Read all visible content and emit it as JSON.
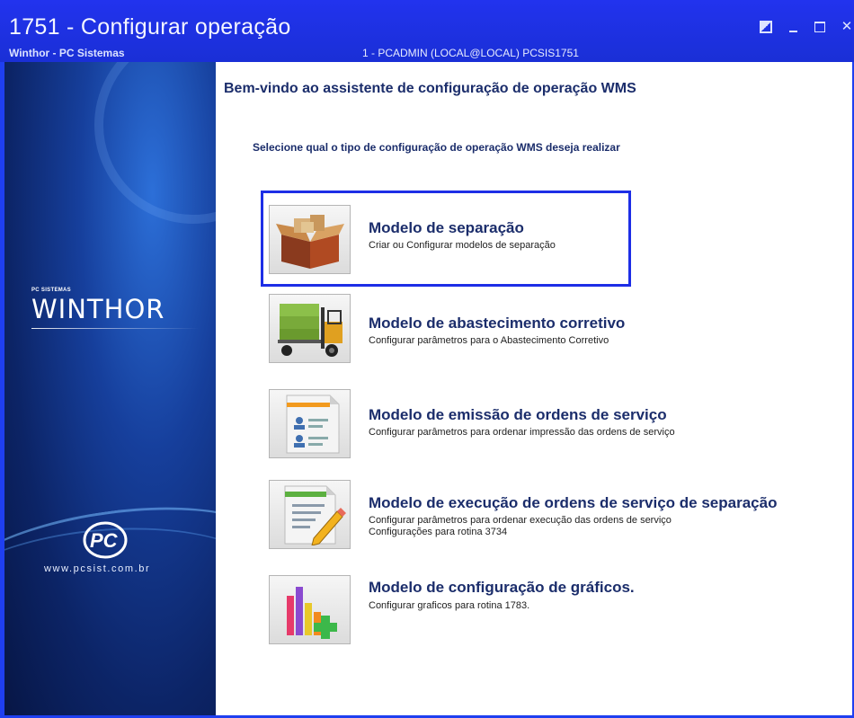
{
  "window": {
    "title": "1751 - Configurar operação",
    "subtitle": "Winthor - PC Sistemas",
    "user_info": "1 - PCADMIN (LOCAL@LOCAL)   PCSIS1751"
  },
  "sidebar": {
    "brand_small": "PC SISTEMAS",
    "brand_name": "WINTHOR",
    "url": "www.pcsist.com.br"
  },
  "main": {
    "welcome": "Bem-vindo ao assistente de configuração de operação WMS",
    "instruction": "Selecione qual o tipo de configuração de operação WMS deseja realizar",
    "options": [
      {
        "title": "Modelo de separação",
        "desc1": "Criar ou Configurar modelos de separação",
        "desc2": "",
        "icon": "box-icon"
      },
      {
        "title": "Modelo de abastecimento corretivo",
        "desc1": "Configurar parâmetros para o Abastecimento Corretivo",
        "desc2": "",
        "icon": "forklift-icon"
      },
      {
        "title": "Modelo de emissão de ordens de serviço",
        "desc1": "Configurar parâmetros para ordenar impressão das ordens de serviço",
        "desc2": "",
        "icon": "document-list-icon"
      },
      {
        "title": "Modelo de execução de ordens de serviço de separação",
        "desc1": "Configurar parâmetros para ordenar execução das ordens de serviço",
        "desc2": "Configurações para rotina 3734",
        "icon": "document-edit-icon"
      },
      {
        "title": "Modelo de configuração de gráficos.",
        "desc1": "Configurar graficos para rotina 1783.",
        "desc2": "",
        "icon": "chart-add-icon"
      }
    ]
  },
  "colors": {
    "window_frame": "#1f3ff0",
    "heading_text": "#1b2d6b",
    "highlight_border": "#1d2ee6"
  }
}
